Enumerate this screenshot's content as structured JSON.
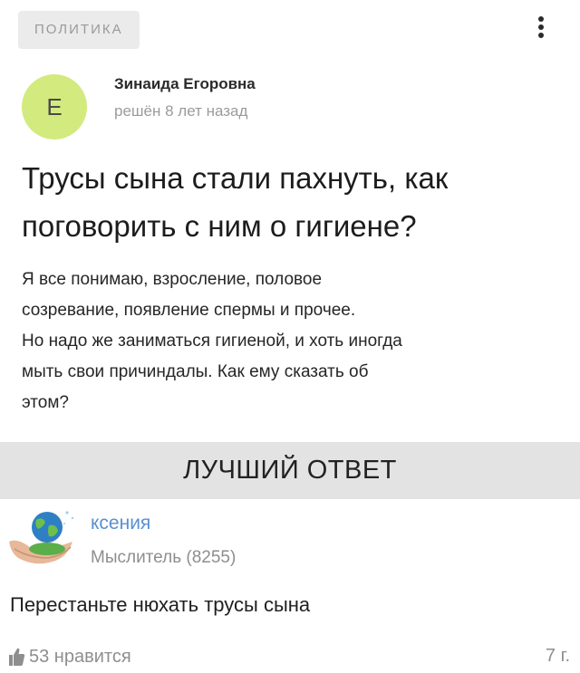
{
  "question": {
    "category": "ПОЛИТИКА",
    "menu_icon": "more-vertical-icon",
    "author": {
      "avatar_letter": "Е",
      "avatar_color": "#d3ea7e",
      "name": "Зинаида Егоровна",
      "status": "решён 8 лет назад"
    },
    "title_lines": [
      "Трусы сына стали пахнуть, как",
      "поговорить с ним о гигиене?"
    ],
    "body_lines": [
      "Я все понимаю, взросление, половое",
      "созревание, появление спермы и прочее.",
      "Но надо же заниматься гигиеной, и хоть иногда",
      "мыть свои причиндалы. Как ему сказать об",
      "этом?"
    ]
  },
  "best_answer": {
    "banner": "ЛУЧШИЙ ОТВЕТ",
    "author": {
      "avatar_icon": "globe-in-hands-icon",
      "name": "ксения",
      "rank": "Мыслитель (8255)"
    },
    "text": "Перестаньте нюхать трусы сына",
    "like_icon": "thumbs-up-icon",
    "likes": "53 нравится",
    "age": "7 г."
  },
  "colors": {
    "link": "#5a8fd3",
    "muted": "#8e8e8e",
    "banner_bg": "#e3e3e3",
    "badge_bg": "#ebebeb"
  }
}
